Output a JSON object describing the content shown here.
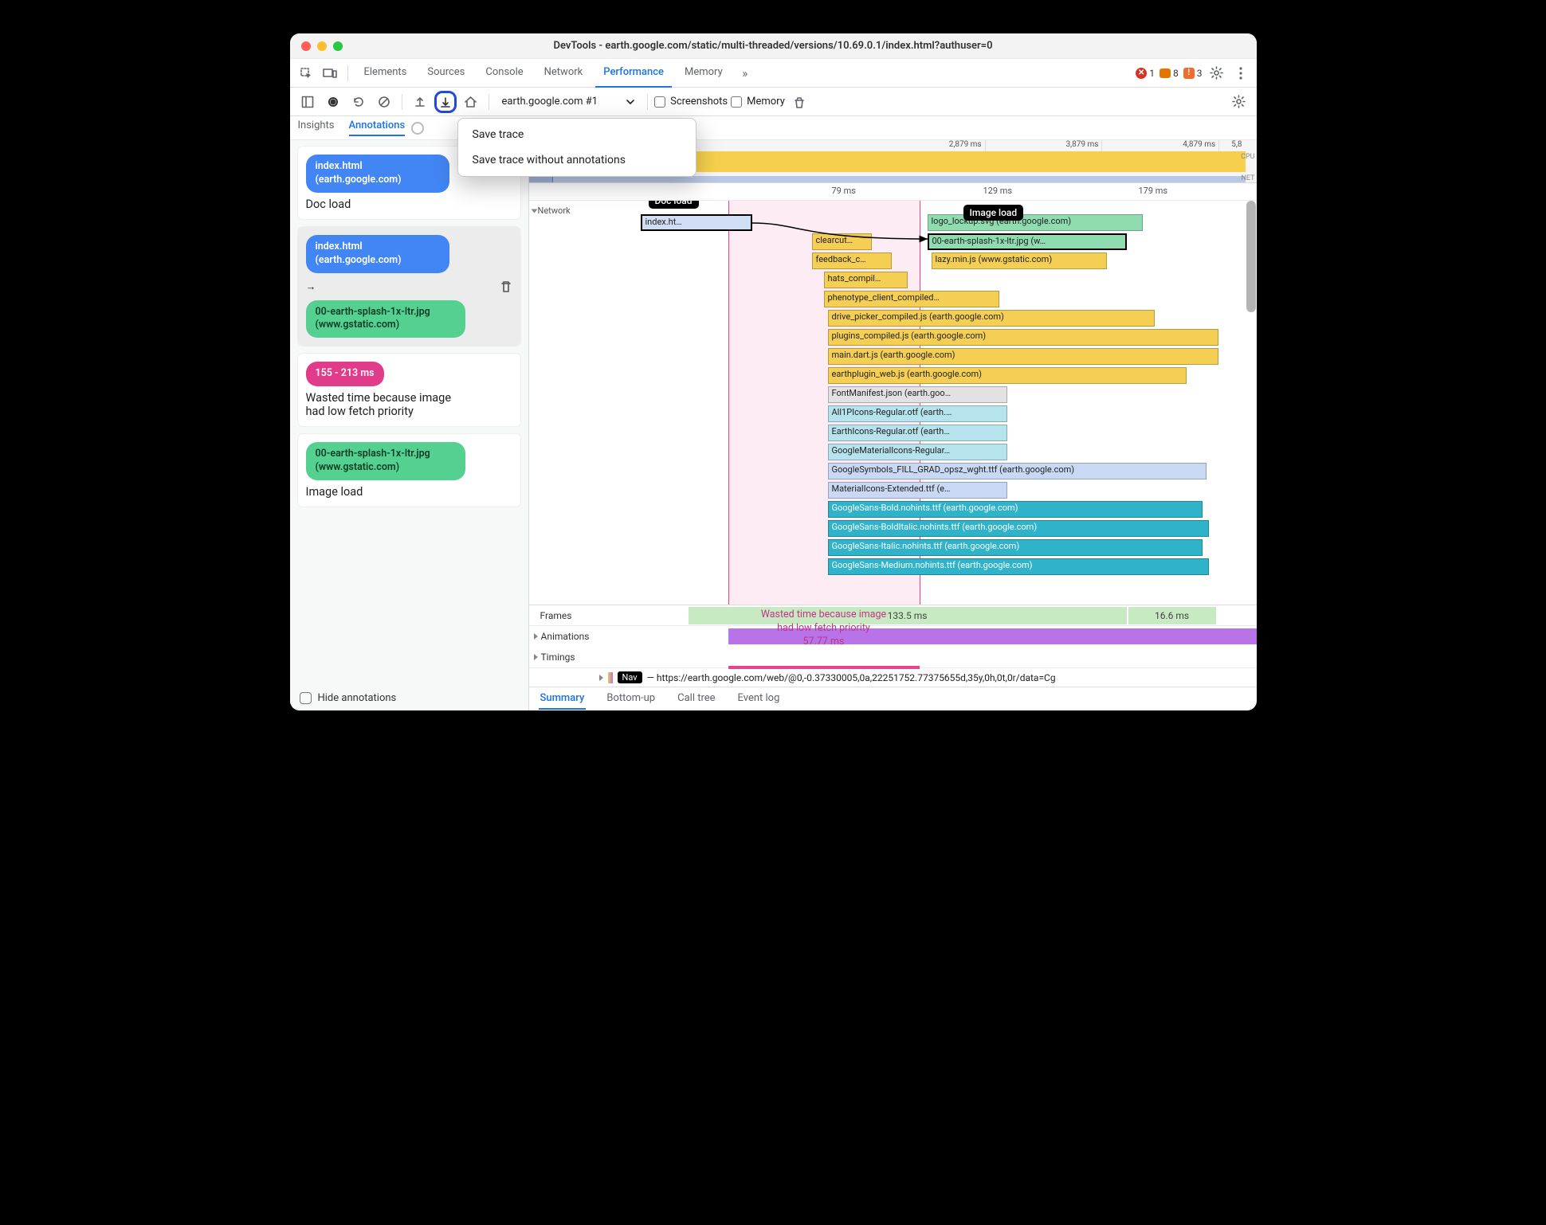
{
  "window": {
    "title": "DevTools - earth.google.com/static/multi-threaded/versions/10.69.0.1/index.html?authuser=0"
  },
  "tabs": {
    "items": [
      "Elements",
      "Sources",
      "Console",
      "Network",
      "Performance",
      "Memory"
    ],
    "active": "Performance",
    "overflow": "»",
    "errors": "1",
    "warnings": "8",
    "violations": "3"
  },
  "toolbar": {
    "trace": "earth.google.com #1",
    "screenshots": "Screenshots",
    "memory": "Memory"
  },
  "menu": {
    "item1": "Save trace",
    "item2": "Save trace without annotations"
  },
  "subtabs": {
    "insights": "Insights",
    "annotations": "Annotations"
  },
  "sidebar": {
    "card1": {
      "chip": "index.html (earth.google.com)",
      "label": "Doc load"
    },
    "card2": {
      "chip1": "index.html (earth.google.com)",
      "chip2": "00-earth-splash-1x-ltr.jpg (www.gstatic.com)"
    },
    "card3": {
      "chip": "155 - 213 ms",
      "label": "Wasted time because image had low fetch priority"
    },
    "card4": {
      "chip": "00-earth-splash-1x-ltr.jpg (www.gstatic.com)",
      "label": "Image load"
    },
    "hide": "Hide annotations"
  },
  "overview": {
    "ticks": [
      "2,879 ms",
      "3,879 ms",
      "4,879 ms",
      "5,8"
    ],
    "cpu": "CPU",
    "net": "NET"
  },
  "ruler": {
    "t1": "79 ms",
    "t2": "129 ms",
    "t3": "179 ms"
  },
  "tracks": {
    "network": "Network",
    "frames": "Frames",
    "animations": "Animations",
    "timings": "Timings"
  },
  "pills": {
    "doc": "Doc load",
    "img": "Image load"
  },
  "bars": {
    "index": "index.ht…",
    "logo": "logo_lockup.svg (earth.google.com)",
    "clearcut": "clearcut…",
    "splash": "00-earth-splash-1x-ltr.jpg (w…",
    "feedback": "feedback_c…",
    "lazy": "lazy.min.js (www.gstatic.com)",
    "hats": "hats_compil…",
    "pheno": "phenotype_client_compiled…",
    "drive": "drive_picker_compiled.js (earth.google.com)",
    "plugins": "plugins_compiled.js (earth.google.com)",
    "maind": "main.dart.js (earth.google.com)",
    "epweb": "earthplugin_web.js (earth.google.com)",
    "fontman": "FontManifest.json (earth.goo…",
    "allp": "All1PIcons-Regular.otf (earth.…",
    "earthi": "EarthIcons-Regular.otf (earth…",
    "gmi": "GoogleMaterialIcons-Regular…",
    "gsym": "GoogleSymbols_FILL_GRAD_opsz_wght.ttf (earth.google.com)",
    "mie": "MaterialIcons-Extended.ttf (e…",
    "gsb": "GoogleSans-Bold.nohints.ttf (earth.google.com)",
    "gsbi": "GoogleSans-BoldItalic.nohints.ttf (earth.google.com)",
    "gsi": "GoogleSans-Italic.nohints.ttf (earth.google.com)",
    "gsm": "GoogleSans-Medium.nohints.ttf (earth.google.com)"
  },
  "frames": {
    "a": "133.5 ms",
    "b": "16.6 ms"
  },
  "wasted": {
    "l1": "Wasted time because image",
    "l2": "had low fetch priority",
    "l3": "57.77 ms"
  },
  "nav": {
    "chip": "Nav",
    "url": "— https://earth.google.com/web/@0,-0.37330005,0a,22251752.77375655d,35y,0h,0t,0r/data=Cg"
  },
  "bottom": {
    "summary": "Summary",
    "bu": "Bottom-up",
    "ct": "Call tree",
    "el": "Event log"
  }
}
